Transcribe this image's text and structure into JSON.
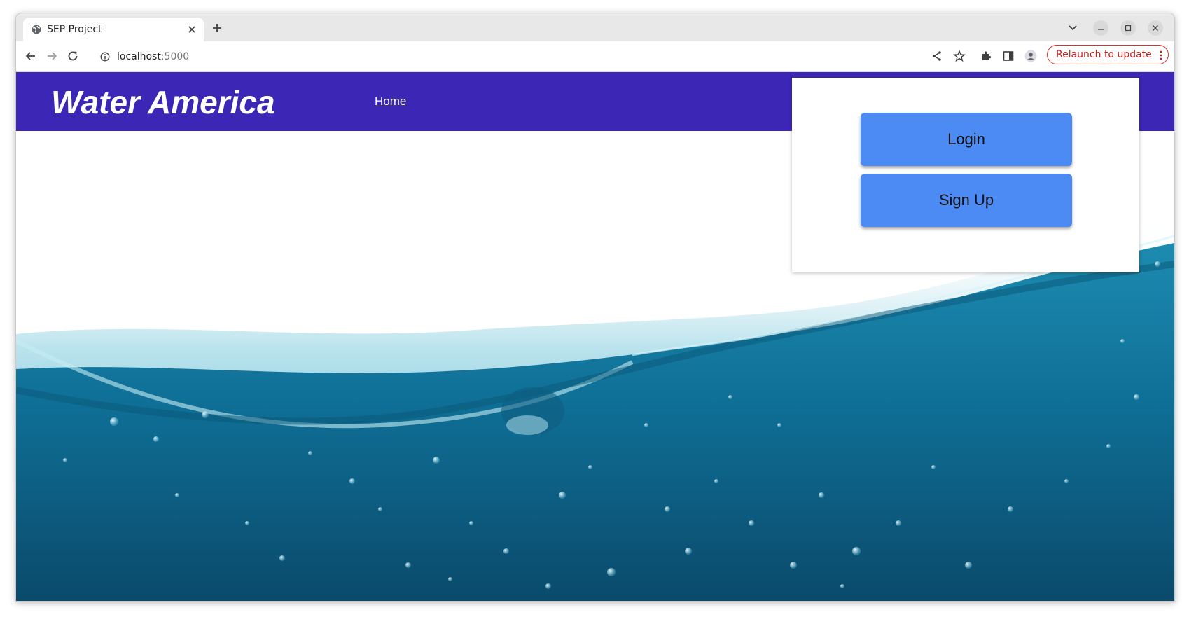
{
  "browser": {
    "tab_title": "SEP Project",
    "url_host": "localhost",
    "url_port": ":5000",
    "relaunch_label": "Relaunch to update"
  },
  "site": {
    "brand": "Water America",
    "nav": {
      "home_label": "Home"
    },
    "header_color": "#3c26b6"
  },
  "auth": {
    "login_label": "Login",
    "signup_label": "Sign Up",
    "button_color": "#4c8af4"
  }
}
